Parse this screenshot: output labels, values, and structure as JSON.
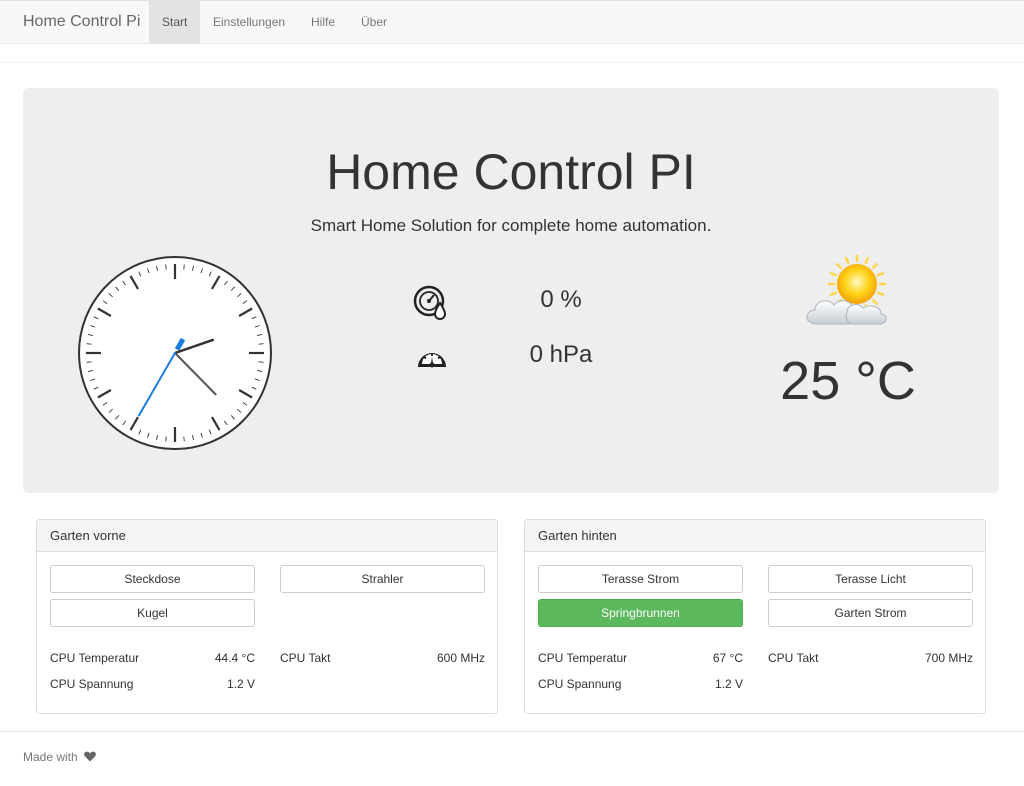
{
  "navbar": {
    "brand": "Home Control Pi",
    "items": [
      {
        "label": "Start",
        "active": true
      },
      {
        "label": "Einstellungen",
        "active": false
      },
      {
        "label": "Hilfe",
        "active": false
      },
      {
        "label": "Über",
        "active": false
      }
    ]
  },
  "hero": {
    "title": "Home Control PI",
    "subtitle": "Smart Home Solution for complete home automation."
  },
  "clock": {
    "hours": 2,
    "minutes": 22,
    "seconds": 35
  },
  "sensors": {
    "humidity": {
      "icon": "humidity-gauge-icon",
      "value": "0 %"
    },
    "pressure": {
      "icon": "barometer-icon",
      "value": "0 hPa"
    }
  },
  "weather": {
    "icon": "partly-cloudy-icon",
    "temperature": "25 °C"
  },
  "panels": [
    {
      "title": "Garten vorne",
      "buttons": [
        {
          "label": "Steckdose",
          "active": false
        },
        {
          "label": "Strahler",
          "active": false
        },
        {
          "label": "Kugel",
          "active": false
        }
      ],
      "stats": [
        {
          "label": "CPU Temperatur",
          "value": "44.4 °C"
        },
        {
          "label": "CPU Takt",
          "value": "600 MHz"
        },
        {
          "label": "CPU Spannung",
          "value": "1.2 V"
        }
      ]
    },
    {
      "title": "Garten hinten",
      "buttons": [
        {
          "label": "Terasse Strom",
          "active": false
        },
        {
          "label": "Terasse Licht",
          "active": false
        },
        {
          "label": "Springbrunnen",
          "active": true
        },
        {
          "label": "Garten Strom",
          "active": false
        }
      ],
      "stats": [
        {
          "label": "CPU Temperatur",
          "value": "67 °C"
        },
        {
          "label": "CPU Takt",
          "value": "700 MHz"
        },
        {
          "label": "CPU Spannung",
          "value": "1.2 V"
        }
      ]
    }
  ],
  "footer": {
    "text": "Made with",
    "icon": "heart-icon"
  },
  "colors": {
    "success": "#5cb85c",
    "jumbotron": "#eeeeee",
    "second_hand": "#1e7be0"
  }
}
